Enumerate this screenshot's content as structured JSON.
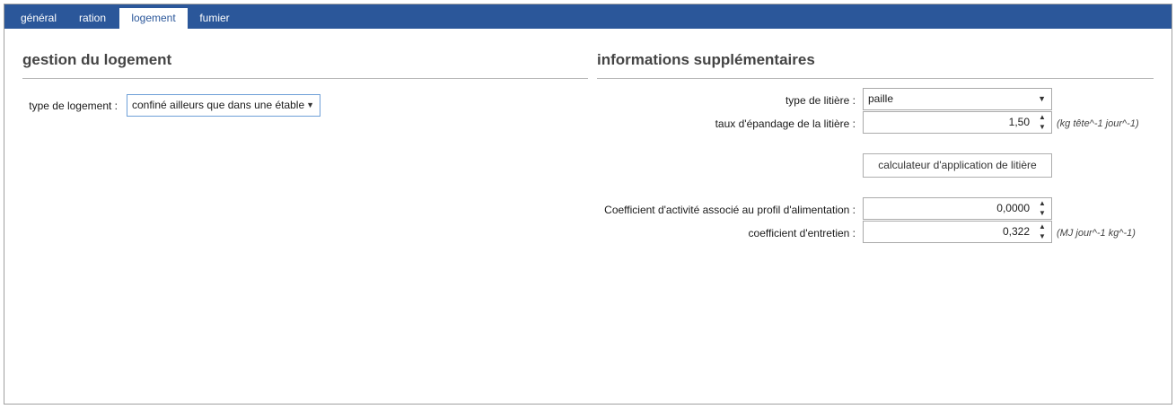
{
  "tabs": [
    {
      "label": "général"
    },
    {
      "label": "ration"
    },
    {
      "label": "logement"
    },
    {
      "label": "fumier"
    }
  ],
  "active_tab": "logement",
  "left": {
    "title": "gestion du logement",
    "housing_type_label": "type de logement :",
    "housing_type_value": "confiné ailleurs que dans une étable"
  },
  "right": {
    "title": "informations supplémentaires",
    "litter_type_label": "type de litière :",
    "litter_type_value": "paille",
    "litter_rate_label": "taux d'épandage de la litière :",
    "litter_rate_value": "1,50",
    "litter_rate_unit": "(kg tête^-1 jour^-1)",
    "calculator_button": "calculateur d'application de litière",
    "activity_coef_label": "Coefficient d'activité associé au profil d'alimentation :",
    "activity_coef_value": "0,0000",
    "maintenance_coef_label": "coefficient d'entretien :",
    "maintenance_coef_value": "0,322",
    "maintenance_coef_unit": "(MJ jour^-1 kg^-1)"
  },
  "icons": {
    "dropdown": "triangle-down",
    "spin_up": "triangle-up",
    "spin_down": "triangle-down"
  },
  "colors": {
    "tabbar": "#2b579a",
    "focus_border": "#6fa0d8"
  }
}
